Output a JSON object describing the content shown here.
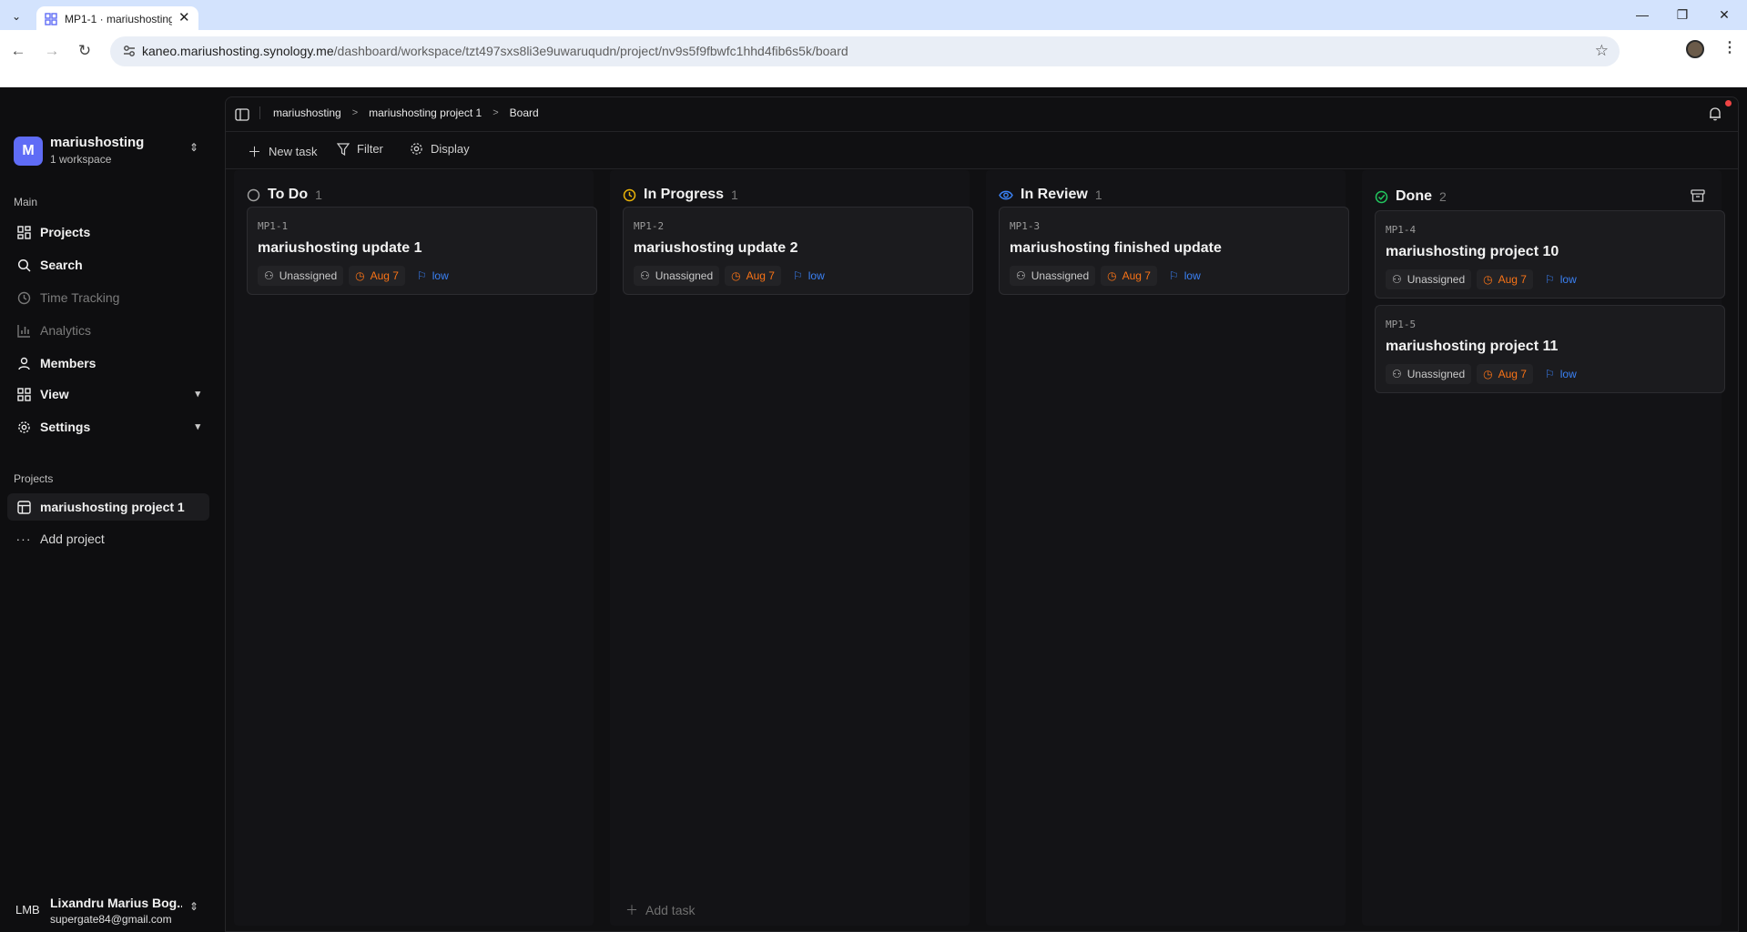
{
  "browser": {
    "tab_title": "MP1-1 · mariushosting",
    "url_host": "kaneo.mariushosting.synology.me",
    "url_path": "/dashboard/workspace/tzt497sxs8li3e9uwaruqudn/project/nv9s5f9fbwfc1hhd4fib6s5k/board"
  },
  "workspace": {
    "logo_letter": "M",
    "name": "mariushosting",
    "subtitle": "1 workspace"
  },
  "sidebar": {
    "main_label": "Main",
    "main_items": [
      {
        "label": "Projects",
        "icon": "grid-icon"
      },
      {
        "label": "Search",
        "icon": "search-icon"
      },
      {
        "label": "Time Tracking",
        "icon": "clock-icon"
      },
      {
        "label": "Analytics",
        "icon": "bar-chart-icon"
      },
      {
        "label": "Members",
        "icon": "user-icon"
      },
      {
        "label": "View",
        "icon": "grid-icon"
      },
      {
        "label": "Settings",
        "icon": "gear-icon"
      }
    ],
    "projects_label": "Projects",
    "projects": [
      {
        "label": "mariushosting project 1"
      }
    ],
    "add_project": "Add project"
  },
  "user": {
    "initials": "LMB",
    "name": "Lixandru Marius Bog...",
    "email": "supergate84@gmail.com"
  },
  "breadcrumb": [
    "mariushosting",
    "mariushosting project 1",
    "Board"
  ],
  "toolbar": {
    "new_task": "New task",
    "filter": "Filter",
    "display": "Display"
  },
  "board": {
    "add_task": "Add task",
    "columns": [
      {
        "title": "To Do",
        "count": "1",
        "status_color": "#a3a3a3",
        "cards": [
          {
            "id": "MP1-1",
            "title": "mariushosting update 1",
            "assignee": "Unassigned",
            "date": "Aug 7",
            "priority": "low"
          }
        ]
      },
      {
        "title": "In Progress",
        "count": "1",
        "status_color": "#eab308",
        "cards": [
          {
            "id": "MP1-2",
            "title": "mariushosting update 2",
            "assignee": "Unassigned",
            "date": "Aug 7",
            "priority": "low"
          }
        ]
      },
      {
        "title": "In Review",
        "count": "1",
        "status_color": "#3b82f6",
        "cards": [
          {
            "id": "MP1-3",
            "title": "mariushosting finished update",
            "assignee": "Unassigned",
            "date": "Aug 7",
            "priority": "low"
          }
        ]
      },
      {
        "title": "Done",
        "count": "2",
        "status_color": "#22c55e",
        "cards": [
          {
            "id": "MP1-4",
            "title": "mariushosting project 10",
            "assignee": "Unassigned",
            "date": "Aug 7",
            "priority": "low"
          },
          {
            "id": "MP1-5",
            "title": "mariushosting project 11",
            "assignee": "Unassigned",
            "date": "Aug 7",
            "priority": "low"
          }
        ]
      }
    ]
  }
}
